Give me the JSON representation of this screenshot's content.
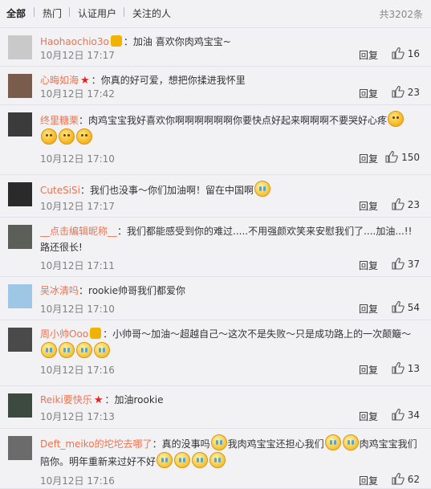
{
  "tabs": [
    "全部",
    "热门",
    "认证用户",
    "关注的人"
  ],
  "total_count": "共3202条",
  "reply_label": "回复",
  "comments": [
    {
      "user": "Haohaochio3o",
      "badge": true,
      "star": false,
      "parts": [
        {
          "t": "加油 喜欢你肉鸡宝宝~"
        }
      ],
      "time": "10月12日 17:17",
      "likes": "16",
      "avatar": "#c9c9c9"
    },
    {
      "user": "心晦如海",
      "badge": false,
      "star": true,
      "parts": [
        {
          "t": "你真的好可爱，想把你揉进我怀里"
        }
      ],
      "time": "10月12日 17:42",
      "likes": "23",
      "avatar": "#7a5c4c"
    },
    {
      "user": "终里糖栗",
      "badge": false,
      "star": false,
      "parts": [
        {
          "t": "肉鸡宝宝我好喜欢你啊啊啊啊啊啊你要快点好起来啊啊啊不要哭好心疼"
        },
        {
          "e": "sad"
        },
        {
          "e": "sad"
        },
        {
          "e": "sad"
        },
        {
          "e": "sad"
        }
      ],
      "time": "10月12日 17:10",
      "likes": "150",
      "avatar": "#3b3b3b"
    },
    {
      "user": "CuteSiSi",
      "badge": false,
      "star": false,
      "parts": [
        {
          "t": "我们也没事～你们加油啊！留在中国啊"
        },
        {
          "e": "cry"
        }
      ],
      "time": "10月12日 17:17",
      "likes": "23",
      "avatar": "#2a2a2a"
    },
    {
      "user": "__点击编辑昵称__",
      "badge": false,
      "star": false,
      "parts": [
        {
          "t": "我们都能感受到你的难过.....不用强颜欢笑来安慰我们了....加油...!!路还很长!"
        }
      ],
      "time": "10月12日 17:11",
      "likes": "37",
      "avatar": "#5a5f58"
    },
    {
      "user": "吴冰清吗",
      "badge": false,
      "star": false,
      "parts": [
        {
          "t": "rookie帅哥我们都爱你"
        }
      ],
      "time": "10月12日 17:10",
      "likes": "54",
      "avatar": "#9ec7e6"
    },
    {
      "user": "周小帅Ooo",
      "badge": true,
      "star": false,
      "parts": [
        {
          "t": "小帅哥～加油～超越自己～这次不是失败～只是成功路上的一次颠簸～"
        },
        {
          "e": "cry"
        },
        {
          "e": "cry"
        },
        {
          "e": "cry"
        },
        {
          "e": "cry"
        }
      ],
      "time": "10月12日 17:16",
      "likes": "13",
      "avatar": "#4a4a4a"
    },
    {
      "user": "Reiki要快乐",
      "badge": false,
      "star": true,
      "parts": [
        {
          "t": "加油rookie"
        }
      ],
      "time": "10月12日 17:13",
      "likes": "34",
      "avatar": "#3d4a3f"
    },
    {
      "user": "Deft_meiko的坨坨去哪了",
      "badge": false,
      "star": false,
      "parts": [
        {
          "t": "真的没事吗"
        },
        {
          "e": "cry"
        },
        {
          "t": "我肉鸡宝宝还担心我们"
        },
        {
          "e": "cry"
        },
        {
          "e": "cry"
        },
        {
          "t": "肉鸡宝宝我们陪你。明年重新来过好不好"
        },
        {
          "e": "cry"
        },
        {
          "e": "cry"
        },
        {
          "e": "cry"
        },
        {
          "e": "cry"
        }
      ],
      "time": "10月12日 17:16",
      "likes": "62",
      "avatar": "#6b6b6b"
    }
  ]
}
